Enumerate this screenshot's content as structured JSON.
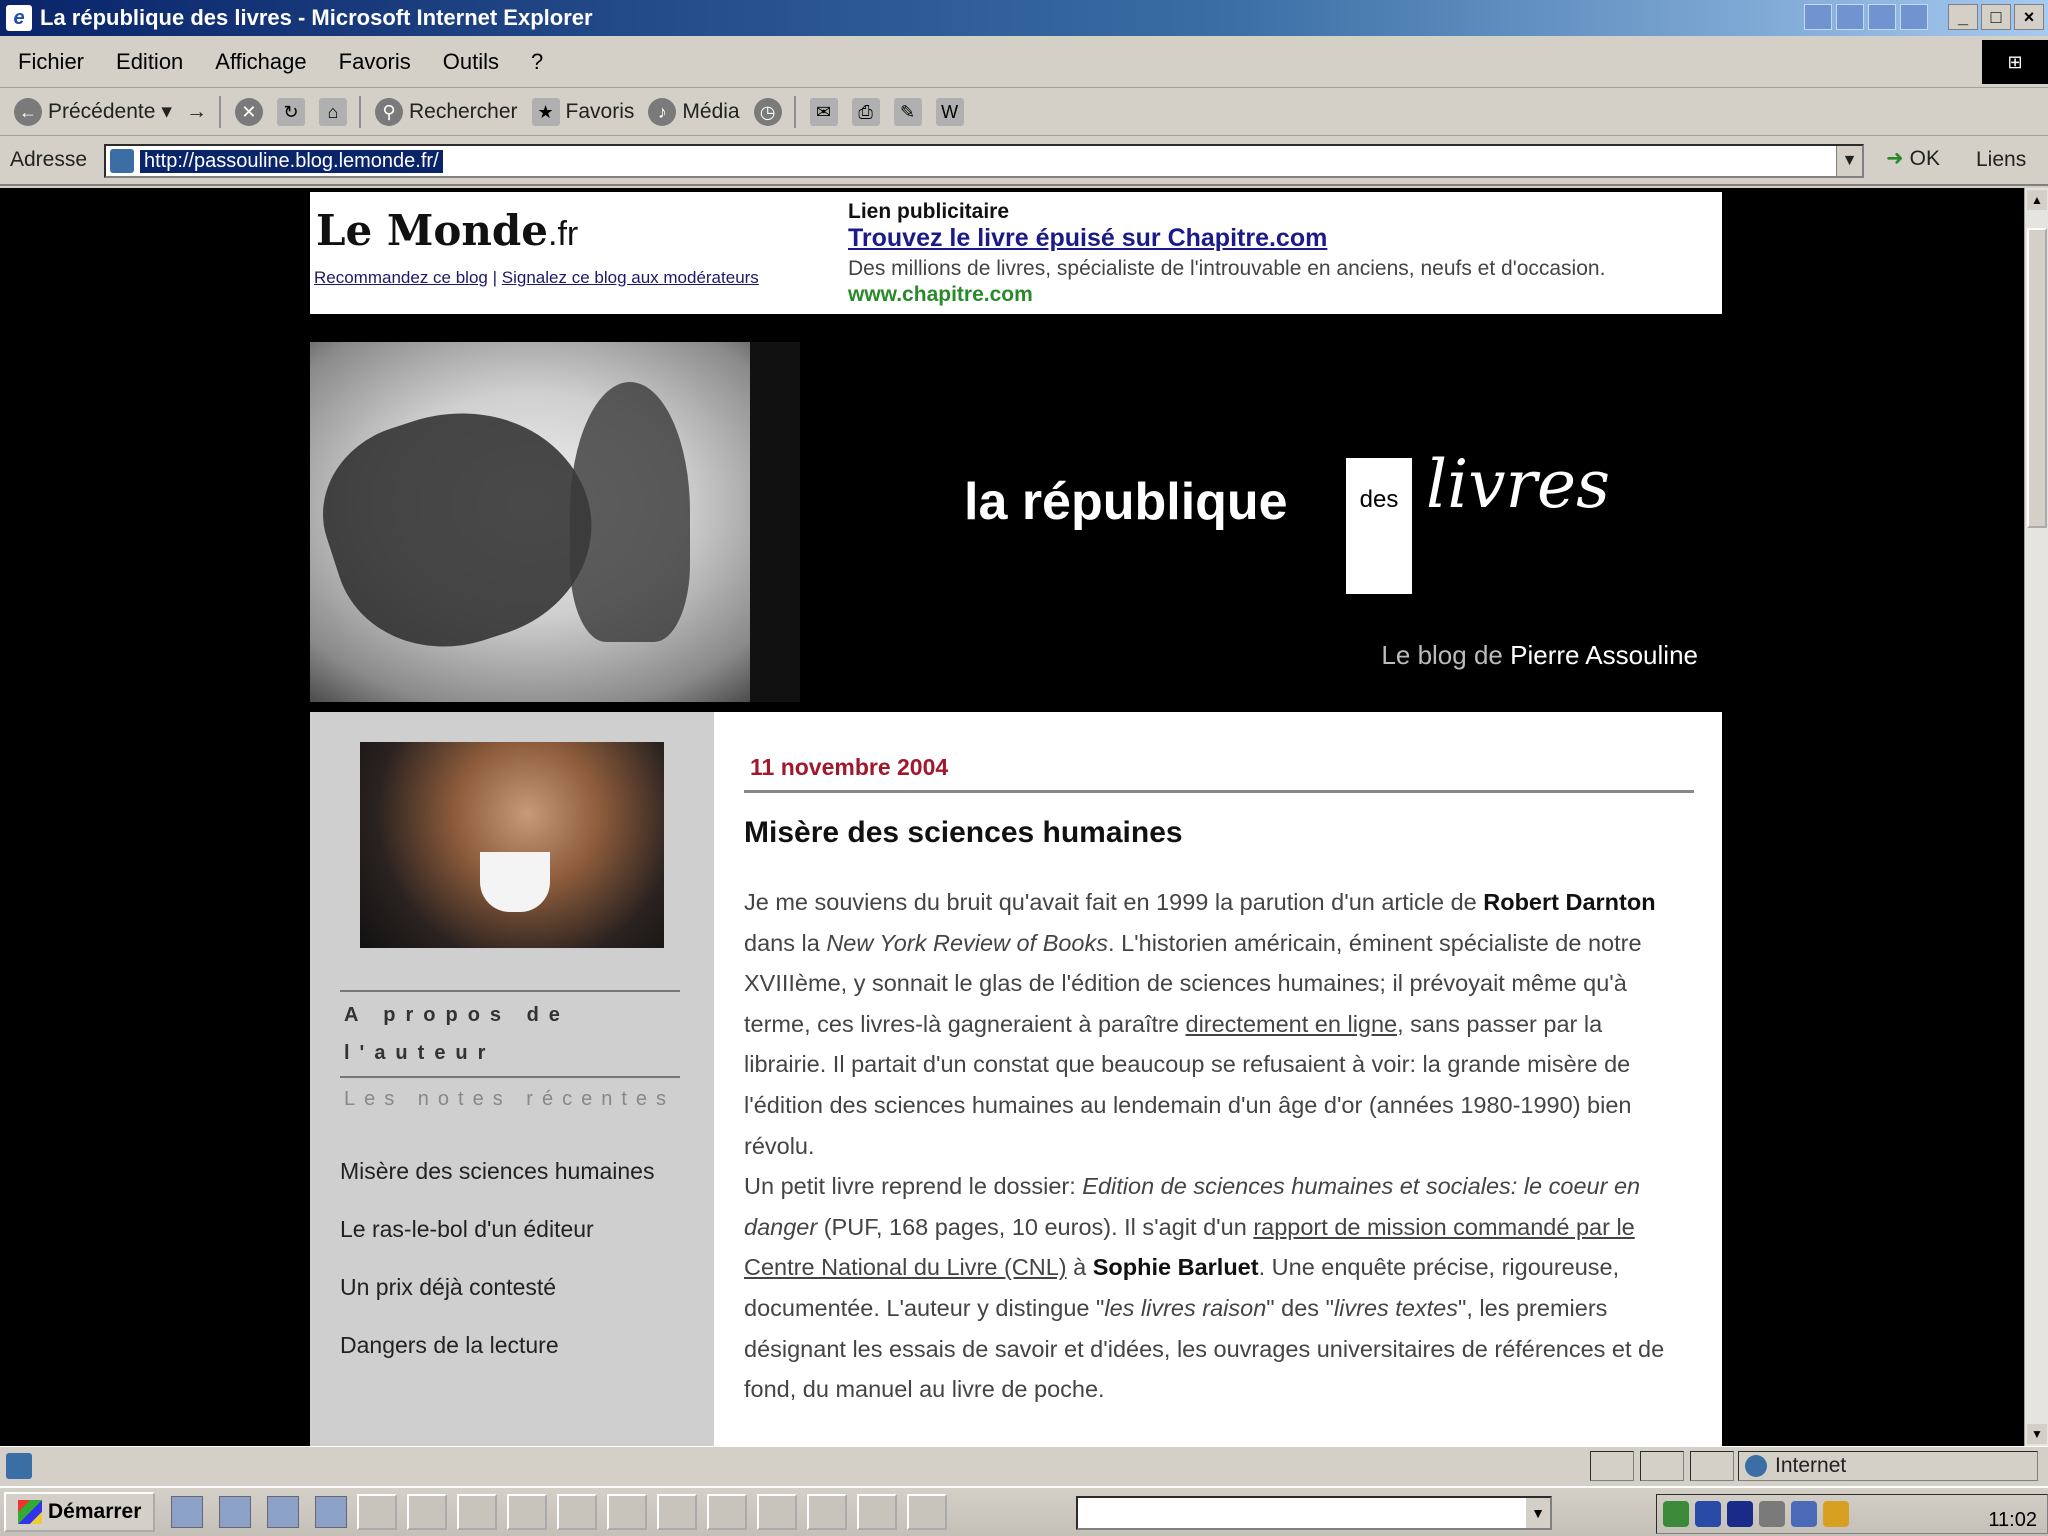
{
  "window": {
    "title": "La république des livres - Microsoft Internet Explorer"
  },
  "menu": [
    "Fichier",
    "Edition",
    "Affichage",
    "Favoris",
    "Outils",
    "?"
  ],
  "toolbar": {
    "back_label": "Précédente",
    "search_label": "Rechercher",
    "favorites_label": "Favoris",
    "media_label": "Média"
  },
  "addressbar": {
    "label": "Adresse",
    "url": "http://passouline.blog.lemonde.fr/",
    "go_label": "OK",
    "links_label": "Liens"
  },
  "banner": {
    "logo_main": "Le Monde",
    "logo_suffix": ".fr",
    "recommend_link": "Recommandez ce blog",
    "report_link": "Signalez ce blog aux modérateurs",
    "link_separator": "|",
    "ad_label": "Lien publicitaire",
    "ad_title": "Trouvez le livre épuisé sur Chapitre.com",
    "ad_desc": "Des millions de livres, spécialiste de l'introuvable en anciens, neufs et d'occasion.",
    "ad_url": "www.chapitre.com"
  },
  "header": {
    "title_part1": "la république",
    "title_des": "des",
    "title_livres": "livres",
    "tagline_prefix": "Le blog de",
    "tagline_name": "Pierre Assouline"
  },
  "sidebar": {
    "about_heading": "A propos de l'auteur",
    "recent_heading": "Les notes récentes",
    "recent_posts": [
      "Misère des sciences humaines",
      "Le ras-le-bol d'un éditeur",
      "Un prix déjà contesté",
      "Dangers de la lecture"
    ]
  },
  "post": {
    "date": "11 novembre 2004",
    "title": "Misère des sciences humaines",
    "p1_a": "Je me souviens du bruit qu'avait fait en 1999 la parution d'un article de ",
    "p1_author": "Robert Darnton",
    "p1_b": " dans la ",
    "p1_journal": "New York Review of Books",
    "p1_c": ". L'historien américain, éminent spécialiste de notre XVIIIème, y sonnait le glas de l'édition de sciences humaines; il prévoyait même qu'à terme, ces livres-là gagneraient à paraître ",
    "p1_link": "directement en ligne,",
    "p1_d": " sans passer par la librairie. Il partait d'un constat que beaucoup se refusaient à voir: la grande misère de l'édition des sciences humaines au lendemain d'un âge d'or (années 1980-1990) bien révolu.",
    "p2_a": "Un petit livre reprend le dossier: ",
    "p2_book": "Edition de sciences humaines et sociales: le coeur en danger",
    "p2_b": " (PUF, 168 pages, 10 euros). Il s'agit d'un ",
    "p2_link": "rapport de mission commandé par le Centre National du Livre (CNL)",
    "p2_c": " à ",
    "p2_person": "Sophie Barluet",
    "p2_d": ". Une enquête précise, rigoureuse, documentée. L'auteur y distingue \"",
    "p2_q1": "les livres raison",
    "p2_e": "\" des \"",
    "p2_q2": "livres textes",
    "p2_f": "\", les premiers désignant les essais de savoir et d'idées, les ouvrages universitaires de références et de fond, du manuel au livre de poche."
  },
  "statusbar": {
    "zone_label": "Internet"
  },
  "taskbar": {
    "start_label": "Démarrer",
    "clock": "11:02"
  }
}
